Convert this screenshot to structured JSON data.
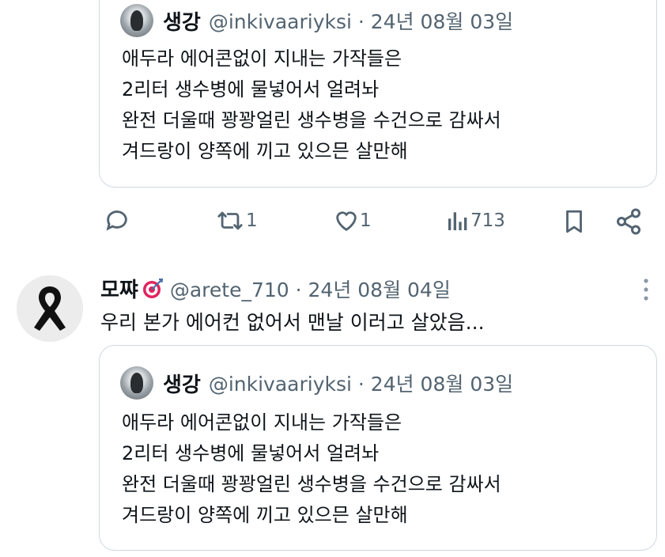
{
  "quoted_tweet_top": {
    "name": "생강",
    "handle_time": "@inkivaariyksi · 24년 08월 03일",
    "lines": [
      "애두라 에어콘없이 지내는 가작들은",
      "2리터 생수병에 물넣어서 얼려놔",
      "완전 더울때 꽝꽝얼린 생수병을 수건으로 감싸서",
      "겨드랑이 양쪽에 끼고 있으믄 살만해"
    ]
  },
  "actions": {
    "reply_icon": "speech-bubble-icon",
    "retweet_count": "1",
    "like_count": "1",
    "views_count": "713",
    "bookmark_icon": "bookmark-icon",
    "share_icon": "share-icon"
  },
  "reply_tweet": {
    "name": "모쨔",
    "emoji": "dart-target-icon",
    "handle_time": "@arete_710 · 24년 08월 04일",
    "text": "우리 본가 에어컨 없어서 맨날 이러고 살았음..."
  },
  "quoted_tweet_bottom": {
    "name": "생강",
    "handle_time": "@inkivaariyksi · 24년 08월 03일",
    "lines": [
      "애두라 에어콘없이 지내는 가작들은",
      "2리터 생수병에 물넣어서 얼려놔",
      "완전 더울때 꽝꽝얼린 생수병을 수건으로 감싸서",
      "겨드랑이 양쪽에 끼고 있으믄 살만해"
    ]
  },
  "colors": {
    "text": "#0f1419",
    "muted": "#536471",
    "border": "#cfd9de"
  }
}
